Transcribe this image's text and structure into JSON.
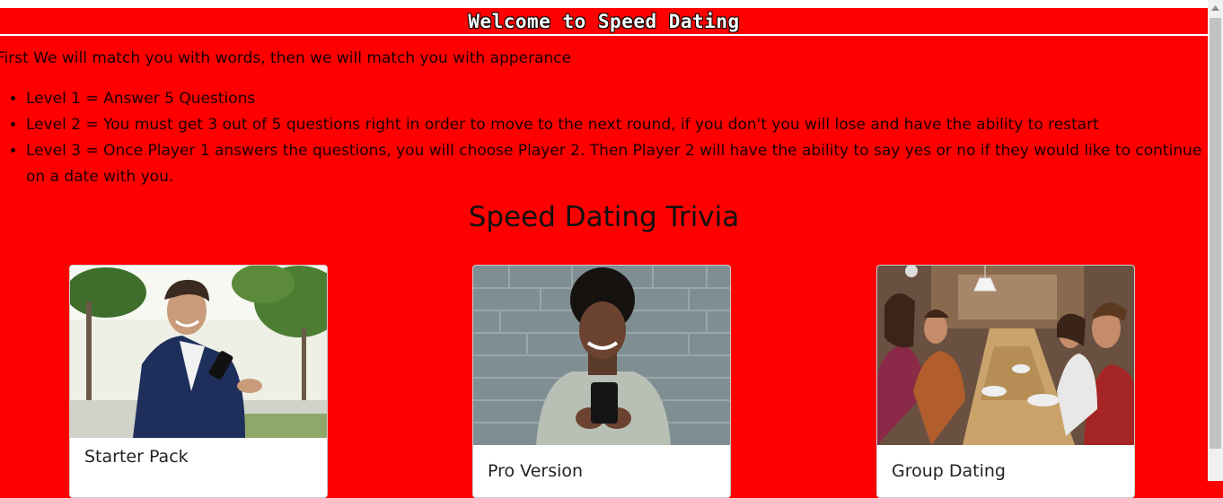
{
  "header": {
    "title": "Welcome to Speed Dating"
  },
  "intro": "First We will match you with words, then we will match you with apperance",
  "levels": [
    "Level 1 = Answer 5 Questions",
    "Level 2 = You must get 3 out of 5 questions right in order to move to the next round, if you don't you will lose and have the ability to restart",
    "Level 3 = Once Player 1 answers the questions, you will choose Player 2. Then Player 2 will have the ability to say yes or no if they would like to continue on a date with you."
  ],
  "section_title": "Speed Dating Trivia",
  "cards": [
    {
      "title": "Starter Pack"
    },
    {
      "title": "Pro Version"
    },
    {
      "title": "Group Dating"
    }
  ],
  "colors": {
    "background": "#ff0000",
    "header_text": "#ffffff",
    "card_bg": "#ffffff"
  },
  "icons": {
    "scroll_up": "chevron-up-icon"
  }
}
